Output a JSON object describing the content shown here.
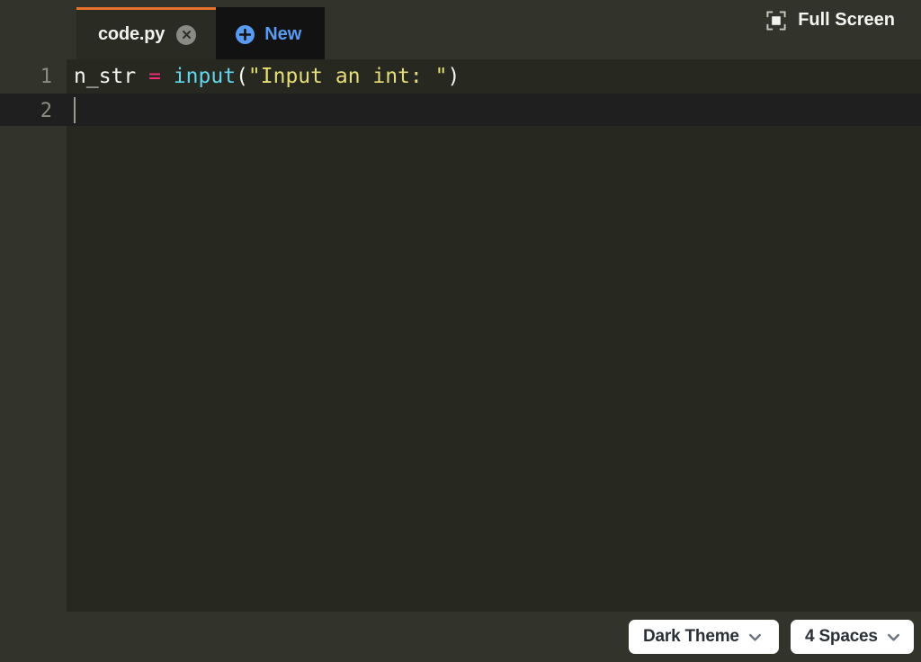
{
  "tabbar": {
    "tabs": [
      {
        "label": "code.py",
        "close_icon": "close-circle-icon",
        "active": true
      },
      {
        "label": "New",
        "icon": "plus-circle-icon",
        "active": false
      }
    ],
    "fullscreen": {
      "label": "Full Screen",
      "icon": "fullscreen-icon"
    }
  },
  "editor": {
    "theme": "Monokai dark",
    "lines": [
      {
        "number": "1",
        "text": "n_str = input(\"Input an int: \")",
        "tokens": [
          {
            "text": "n_str ",
            "type": "plain"
          },
          {
            "text": "=",
            "type": "operator"
          },
          {
            "text": " ",
            "type": "plain"
          },
          {
            "text": "input",
            "type": "function"
          },
          {
            "text": "(",
            "type": "plain"
          },
          {
            "text": "\"Input an int: \"",
            "type": "string"
          },
          {
            "text": ")",
            "type": "plain"
          }
        ]
      },
      {
        "number": "2",
        "text": "",
        "tokens": []
      }
    ],
    "active_line": "2",
    "colors": {
      "background": "#272820",
      "gutter": "#32332b",
      "active_line": "#1f1f1f",
      "plain": "#f6f6f0",
      "operator": "#f22f75",
      "function": "#63d6ef",
      "string": "#e6dd78",
      "line_number": "#8c8d83",
      "tab_accent": "#e8722c",
      "new_tab_accent": "#589bf0"
    }
  },
  "bottombar": {
    "theme_select": {
      "value": "Dark Theme",
      "icon": "chevron-down-icon"
    },
    "indent_select": {
      "value": "4 Spaces",
      "icon": "chevron-down-icon"
    }
  }
}
